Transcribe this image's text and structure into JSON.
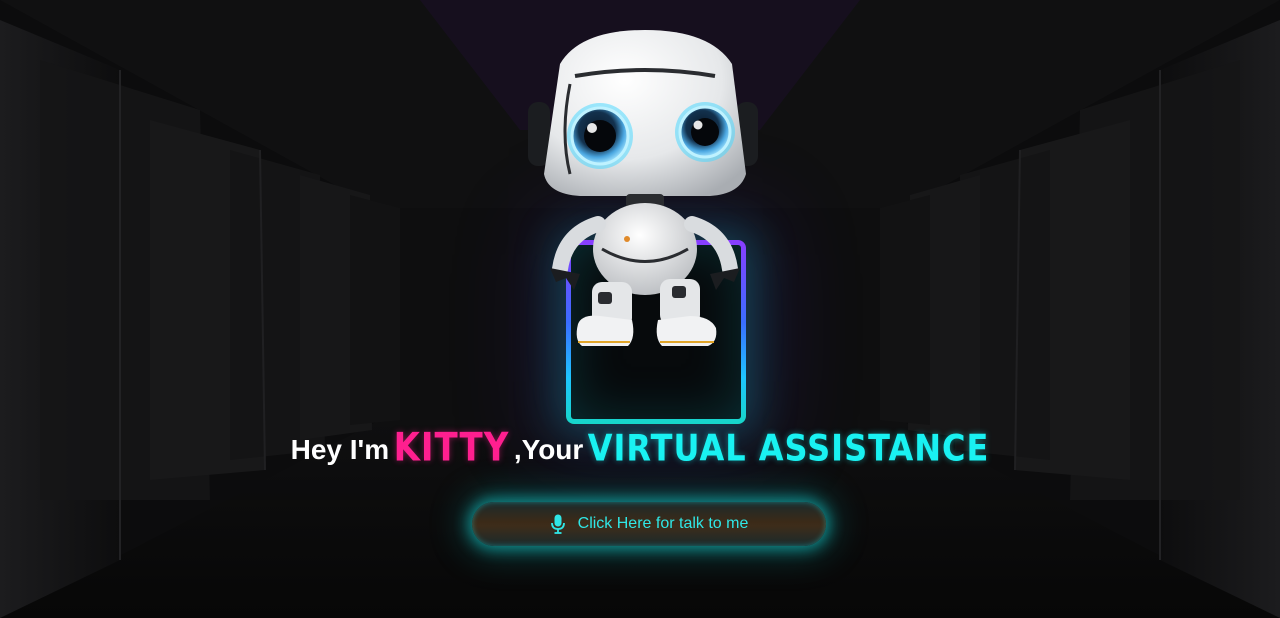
{
  "hero": {
    "greeting": "Hey I'm",
    "name": "KITTY",
    "connector": ",Your",
    "role": "VIRTUAL ASSISTANCE"
  },
  "talk_button": {
    "label": "Click Here for talk to me",
    "icon": "microphone-icon"
  },
  "colors": {
    "name_accent": "#ff1f8f",
    "role_accent": "#19f2f2",
    "button_text": "#2fe6e6"
  }
}
